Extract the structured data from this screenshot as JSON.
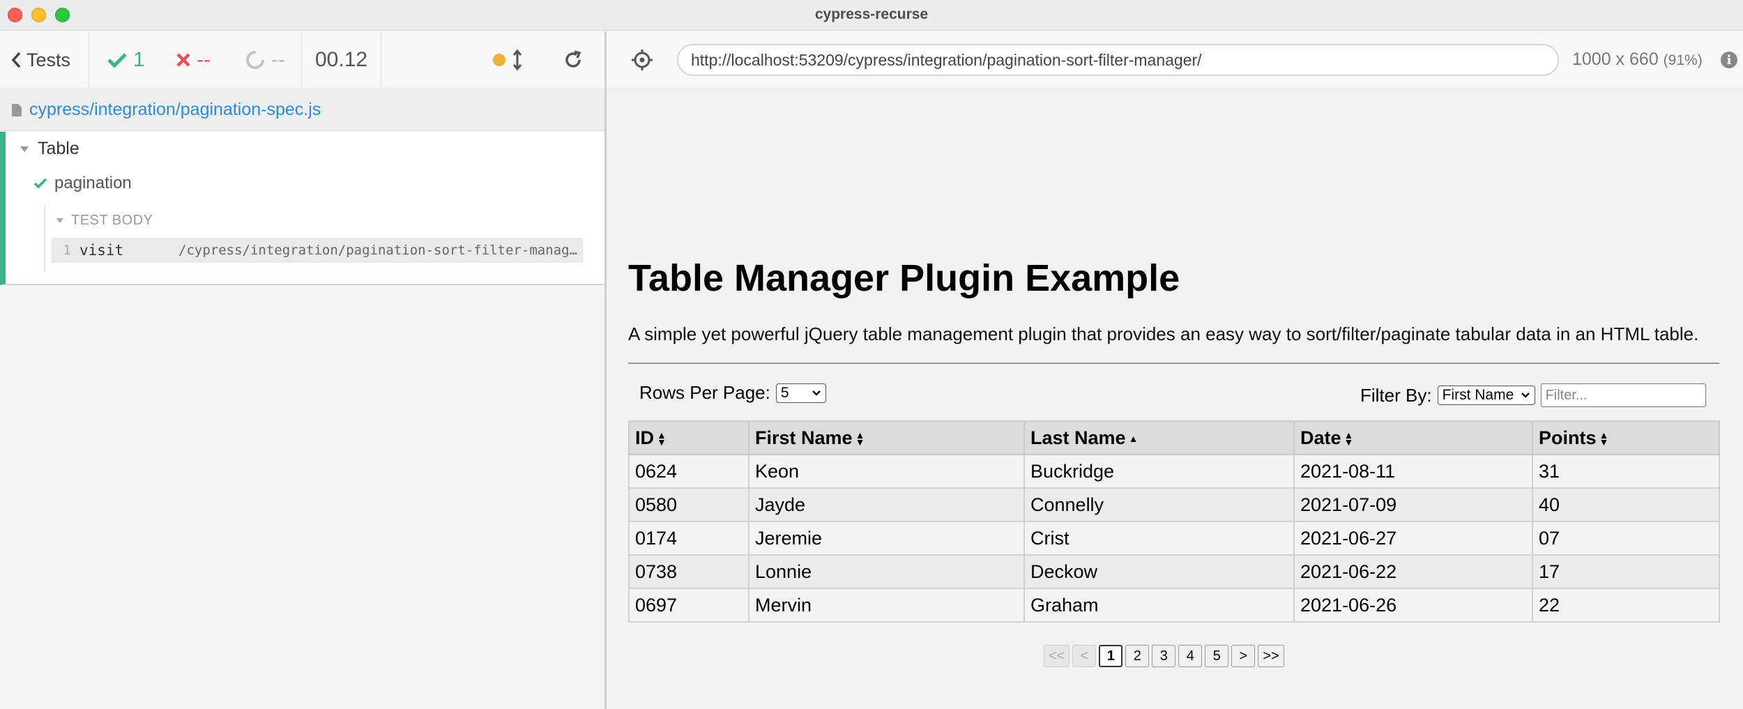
{
  "window": {
    "title": "cypress-recurse"
  },
  "reporter": {
    "tests_label": "Tests",
    "passed": "1",
    "failed": "--",
    "pending": "--",
    "duration": "00.12",
    "spec_path": "cypress/integration/pagination-spec.js",
    "suite_title": "Table",
    "test_title": "pagination",
    "body_label": "TEST BODY",
    "commands": [
      {
        "number": "1",
        "name": "visit",
        "message": "/cypress/integration/pagination-sort-filter-manager/"
      }
    ]
  },
  "aut": {
    "url": "http://localhost:53209/cypress/integration/pagination-sort-filter-manager/",
    "viewport": "1000 x 660",
    "scale": "(91%)",
    "info_glyph": "i"
  },
  "page": {
    "title": "Table Manager Plugin Example",
    "description": "A simple yet powerful jQuery table management plugin that provides an easy way to sort/filter/paginate tabular data in an HTML table.",
    "rows_per_page_label": "Rows Per Page:",
    "rows_per_page_value": "5",
    "filter_label": "Filter By:",
    "filter_column": "First Name",
    "filter_placeholder": "Filter...",
    "table": {
      "headers": [
        "ID",
        "First Name",
        "Last Name",
        "Date",
        "Points"
      ],
      "rows": [
        [
          "0624",
          "Keon",
          "Buckridge",
          "2021-08-11",
          "31"
        ],
        [
          "0580",
          "Jayde",
          "Connelly",
          "2021-07-09",
          "40"
        ],
        [
          "0174",
          "Jeremie",
          "Crist",
          "2021-06-27",
          "07"
        ],
        [
          "0738",
          "Lonnie",
          "Deckow",
          "2021-06-22",
          "17"
        ],
        [
          "0697",
          "Mervin",
          "Graham",
          "2021-06-26",
          "22"
        ]
      ]
    },
    "pagination": [
      "<<",
      "<",
      "1",
      "2",
      "3",
      "4",
      "5",
      ">",
      ">>"
    ],
    "current_page": "1"
  },
  "colors": {
    "pass": "#3bb38a",
    "fail": "#e94f5a",
    "link": "#2f8bd6",
    "auto_scroll": "#f0b23c"
  }
}
